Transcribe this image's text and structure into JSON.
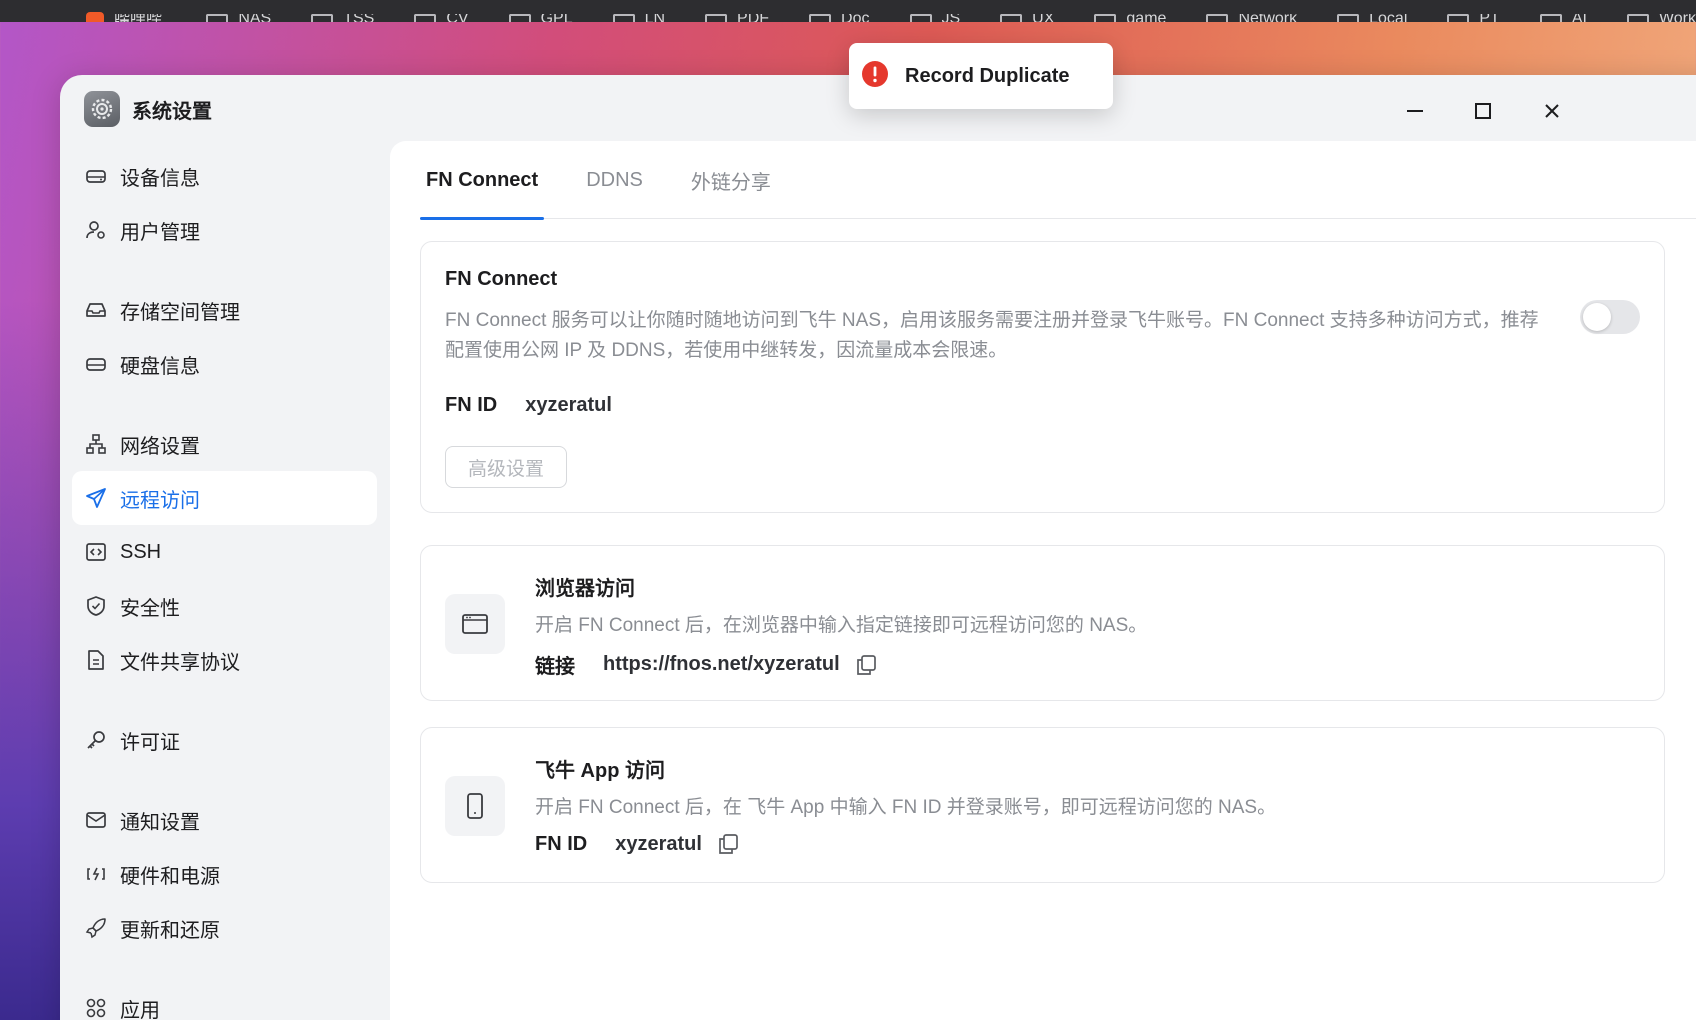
{
  "bookmarks": [
    {
      "label": "",
      "type": "partial"
    },
    {
      "label": "哔哩哔哩",
      "type": "app"
    },
    {
      "label": "NAS",
      "type": "folder"
    },
    {
      "label": "TSS",
      "type": "folder"
    },
    {
      "label": "CV",
      "type": "folder"
    },
    {
      "label": "GPL",
      "type": "folder"
    },
    {
      "label": "LN",
      "type": "folder"
    },
    {
      "label": "PDF",
      "type": "folder"
    },
    {
      "label": "Doc",
      "type": "folder"
    },
    {
      "label": "JS",
      "type": "folder"
    },
    {
      "label": "UX",
      "type": "folder"
    },
    {
      "label": "game",
      "type": "folder"
    },
    {
      "label": "Network",
      "type": "folder"
    },
    {
      "label": "Local",
      "type": "folder"
    },
    {
      "label": "PT",
      "type": "folder"
    },
    {
      "label": "AI",
      "type": "folder"
    },
    {
      "label": "Work",
      "type": "folder"
    }
  ],
  "toast": {
    "message": "Record Duplicate",
    "icon": "error-icon",
    "color": "#e5382d"
  },
  "window": {
    "title": "系统设置"
  },
  "sidebar": {
    "items": [
      {
        "label": "设备信息",
        "icon": "drive-icon"
      },
      {
        "label": "用户管理",
        "icon": "user-gear-icon"
      },
      {
        "label": "存储空间管理",
        "icon": "inbox-icon"
      },
      {
        "label": "硬盘信息",
        "icon": "hdd-icon"
      },
      {
        "label": "网络设置",
        "icon": "network-icon"
      },
      {
        "label": "远程访问",
        "icon": "send-icon",
        "active": true
      },
      {
        "label": "SSH",
        "icon": "code-icon"
      },
      {
        "label": "安全性",
        "icon": "shield-icon"
      },
      {
        "label": "文件共享协议",
        "icon": "document-icon"
      },
      {
        "label": "许可证",
        "icon": "key-icon"
      },
      {
        "label": "通知设置",
        "icon": "mail-icon"
      },
      {
        "label": "硬件和电源",
        "icon": "power-icon"
      },
      {
        "label": "更新和还原",
        "icon": "rocket-icon"
      },
      {
        "label": "应用",
        "icon": "apps-icon"
      }
    ]
  },
  "tabs": [
    {
      "label": "FN Connect",
      "active": true
    },
    {
      "label": "DDNS"
    },
    {
      "label": "外链分享"
    }
  ],
  "fn_connect": {
    "title": "FN Connect",
    "description": "FN Connect 服务可以让你随时随地访问到飞牛 NAS，启用该服务需要注册并登录飞牛账号。FN Connect 支持多种访问方式，推荐配置使用公网 IP 及 DDNS，若使用中继转发，因流量成本会限速。",
    "enabled": false,
    "id_label": "FN ID",
    "id_value": "xyzeratul",
    "advanced_button": "高级设置"
  },
  "browser_access": {
    "title": "浏览器访问",
    "description": "开启 FN Connect 后，在浏览器中输入指定链接即可远程访问您的 NAS。",
    "link_label": "链接",
    "link_value": "https://fnos.net/xyzeratul"
  },
  "app_access": {
    "title": "飞牛 App 访问",
    "description": "开启 FN Connect 后，在 飞牛 App 中输入 FN ID 并登录账号，即可远程访问您的 NAS。",
    "id_label": "FN ID",
    "id_value": "xyzeratul"
  },
  "colors": {
    "accent": "#1a6fe8",
    "error": "#e5382d"
  }
}
